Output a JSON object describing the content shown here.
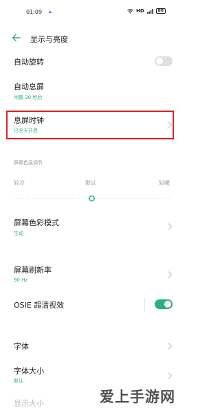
{
  "status": {
    "time": "01:09",
    "network": "HD",
    "battery": "88"
  },
  "header": {
    "title": "显示与亮度"
  },
  "items": [
    {
      "title": "自动旋转"
    },
    {
      "title": "自动息屏",
      "subtitle": "闲置 30 秒后"
    },
    {
      "title": "息屏时钟",
      "subtitle": "已全天开启"
    },
    {
      "title": "屏幕色彩模式",
      "subtitle": "生动"
    },
    {
      "title": "屏幕刷新率",
      "subtitle": "90 Hz"
    },
    {
      "title": "OSIE 超清视效"
    },
    {
      "title": "字体"
    },
    {
      "title": "字体大小",
      "subtitle": "默认"
    },
    {
      "title": "显示大小"
    }
  ],
  "color_temp": {
    "label": "屏幕色温调节",
    "cooler": "较冷",
    "default": "默认",
    "warmer": "较暖",
    "level": 0.5
  },
  "toggles": {
    "auto_rotate": false,
    "osie": true
  },
  "colors": {
    "accent": "#2cae83",
    "highlight": "#e02020",
    "toggle_off": "#e0e0e0"
  },
  "watermark": "爱上手游网"
}
